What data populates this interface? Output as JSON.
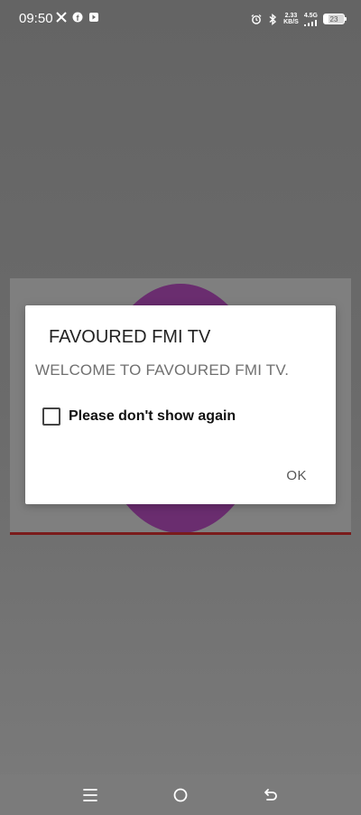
{
  "status_bar": {
    "time": "09:50",
    "left_icons": [
      "x-icon",
      "facebook-icon",
      "notification-icon"
    ],
    "net_speed_value": "2.33",
    "net_speed_unit": "KB/S",
    "network_type": "4.5G",
    "battery_level": "23"
  },
  "dialog": {
    "title": "FAVOURED FMI TV",
    "message": "WELCOME TO FAVOURED FMI TV.",
    "checkbox_label": "Please don't show again",
    "checkbox_checked": false,
    "ok_label": "OK"
  },
  "nav_bar": {
    "buttons": [
      "menu-icon",
      "home-icon",
      "back-icon"
    ]
  },
  "colors": {
    "dim_background": "#6b6b6b",
    "dialog_background": "#ffffff",
    "globe": "#6a2d6f",
    "accent_line": "#7a1b1b"
  }
}
